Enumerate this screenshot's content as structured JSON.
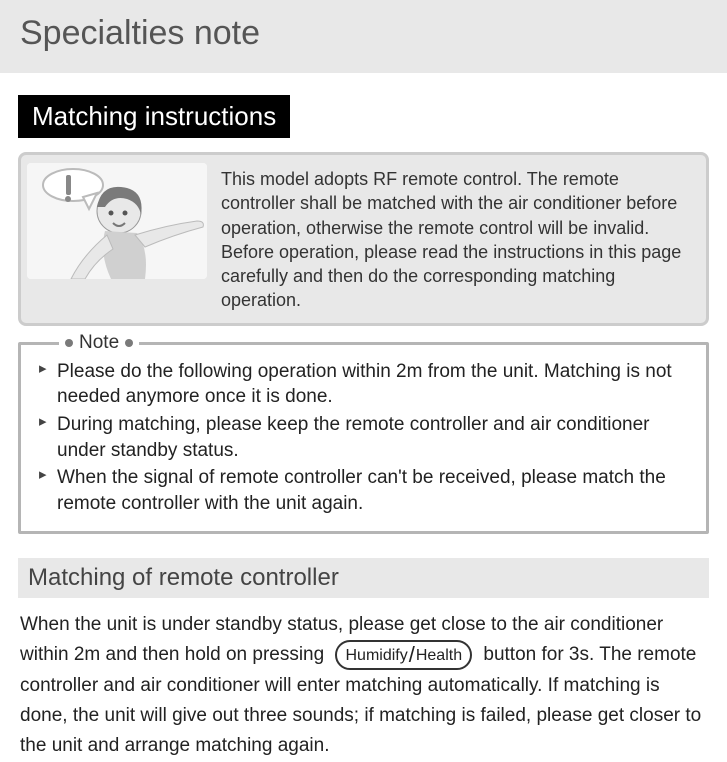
{
  "header": {
    "title": "Specialties note"
  },
  "section1": {
    "title": "Matching instructions",
    "info_line1": "This model adopts RF remote control. The remote controller shall be matched with the air conditioner before operation, otherwise the remote control will be invalid.",
    "info_line2": "Before operation, please read the instructions in this page carefully and then do the corresponding matching operation."
  },
  "note": {
    "label": "Note",
    "items": [
      "Please do the following operation within 2m from the unit. Matching is not needed anymore once it is done.",
      "During matching, please keep the remote controller and air conditioner under standby status.",
      "When the signal of remote controller can't be received, please match the remote controller with the unit again."
    ]
  },
  "section2": {
    "title": "Matching of remote controller",
    "para_before": "When the unit is under standby status, please get close to the air conditioner within 2m and then hold on pressing",
    "button_left": "Humidify",
    "button_right": "Health",
    "para_after": "button for 3s. The remote controller and air conditioner will enter matching automatically. If matching is done, the unit will give out three sounds; if matching is failed, please get closer to the unit and arrange matching again."
  }
}
